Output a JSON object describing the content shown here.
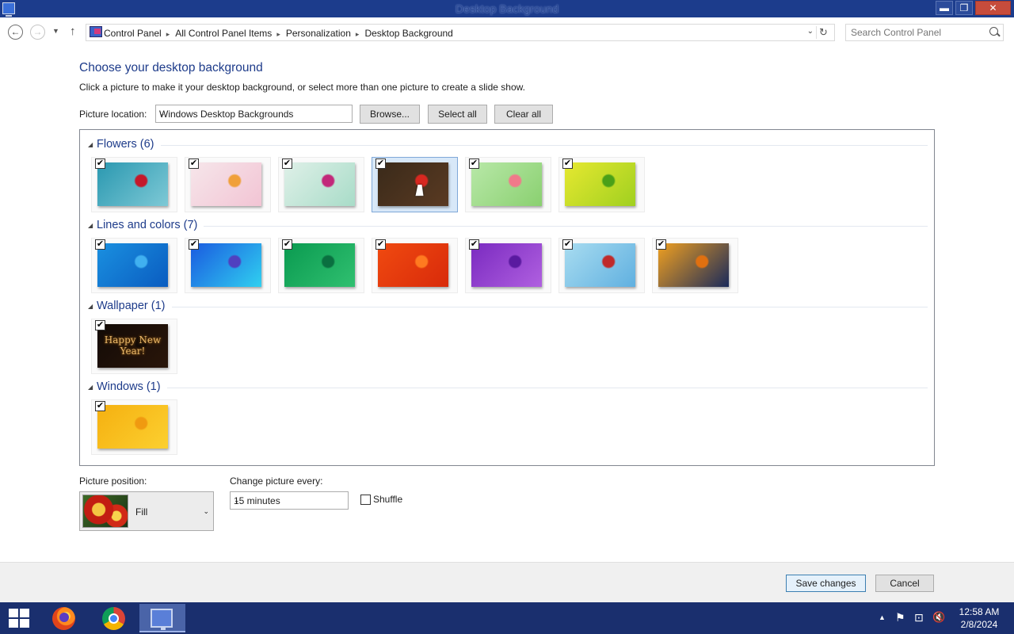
{
  "window": {
    "title": "Desktop Background",
    "min_glyph": "▬",
    "max_glyph": "❐",
    "close_glyph": "✕"
  },
  "nav": {
    "back_glyph": "←",
    "forward_glyph": "→",
    "recent_glyph": "▼",
    "up_glyph": "↑",
    "breadcrumbs": [
      "Control Panel",
      "All Control Panel Items",
      "Personalization",
      "Desktop Background"
    ],
    "crumb_sep": "▸",
    "dropdown_glyph": "⌄",
    "refresh_glyph": "↻",
    "search_placeholder": "Search Control Panel"
  },
  "heading": "Choose your desktop background",
  "subtext": "Click a picture to make it your desktop background, or select more than one picture to create a slide show.",
  "location": {
    "label": "Picture location:",
    "value": "Windows Desktop Backgrounds",
    "browse": "Browse...",
    "select_all": "Select all",
    "clear_all": "Clear all"
  },
  "groups": [
    {
      "name": "Flowers (6)",
      "items": [
        {
          "checked": true,
          "selected": false,
          "colors": [
            "#2a98b0",
            "#7ec9d6",
            "#c4182a"
          ]
        },
        {
          "checked": true,
          "selected": false,
          "colors": [
            "#f6e6ea",
            "#f2c4d4",
            "#f0a03a"
          ]
        },
        {
          "checked": true,
          "selected": false,
          "colors": [
            "#dff0e8",
            "#a8dcc8",
            "#c2287a"
          ]
        },
        {
          "checked": true,
          "selected": true,
          "colors": [
            "#3a2a1a",
            "#5a3a22",
            "#d82820"
          ]
        },
        {
          "checked": true,
          "selected": false,
          "colors": [
            "#b8e8a8",
            "#8ad070",
            "#f07a8a"
          ]
        },
        {
          "checked": true,
          "selected": false,
          "colors": [
            "#e6e830",
            "#a0d020",
            "#4aa018"
          ]
        }
      ]
    },
    {
      "name": "Lines and colors (7)",
      "items": [
        {
          "checked": true,
          "selected": false,
          "colors": [
            "#1a90e0",
            "#0a5cc0",
            "#40b0f0"
          ]
        },
        {
          "checked": true,
          "selected": false,
          "colors": [
            "#1a5ae0",
            "#30d0f0",
            "#5040c0"
          ]
        },
        {
          "checked": true,
          "selected": false,
          "colors": [
            "#0a9a50",
            "#30c070",
            "#0a7040"
          ]
        },
        {
          "checked": true,
          "selected": false,
          "colors": [
            "#f04a10",
            "#d82a0a",
            "#ff7a20"
          ]
        },
        {
          "checked": true,
          "selected": false,
          "colors": [
            "#7a2ac0",
            "#b060e0",
            "#5a1aa0"
          ]
        },
        {
          "checked": true,
          "selected": false,
          "colors": [
            "#a8dcf0",
            "#60b0e0",
            "#c02a2a"
          ]
        },
        {
          "checked": true,
          "selected": false,
          "colors": [
            "#f0a020",
            "#1a2a5a",
            "#e07010"
          ]
        }
      ]
    },
    {
      "name": "Wallpaper (1)",
      "items": [
        {
          "checked": true,
          "selected": false,
          "colors": [
            "#120a06",
            "#2a160a",
            "#120a06"
          ],
          "caption": "Happy New Year!"
        }
      ]
    },
    {
      "name": "Windows (1)",
      "items": [
        {
          "checked": true,
          "selected": false,
          "colors": [
            "#f5b010",
            "#fcd030",
            "#f09a10"
          ]
        }
      ]
    }
  ],
  "checkmark": "✔",
  "collapse_glyph": "◢",
  "position": {
    "label": "Picture position:",
    "value": "Fill"
  },
  "interval": {
    "label": "Change picture every:",
    "value": "15 minutes"
  },
  "shuffle": {
    "label": "Shuffle",
    "checked": false
  },
  "select_glyph": "⌄",
  "footer": {
    "save": "Save changes",
    "cancel": "Cancel"
  },
  "taskbar": {
    "apps": [
      "firefox-icon",
      "chrome-icon",
      "control-panel-icon"
    ],
    "tray_up_glyph": "▲",
    "flag_glyph": "⚑",
    "network_glyph": "⊡",
    "volume_glyph": "🔇",
    "time": "12:58 AM",
    "date": "2/8/2024"
  }
}
